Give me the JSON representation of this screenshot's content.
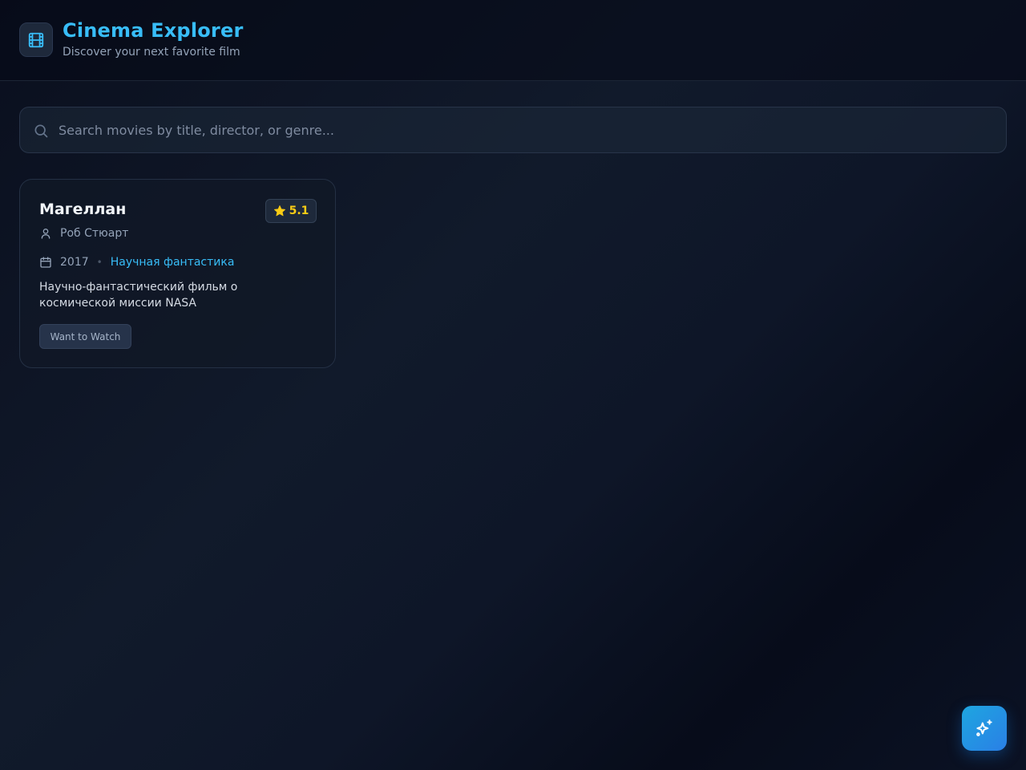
{
  "app": {
    "title": "Cinema Explorer",
    "subtitle": "Discover your next favorite film",
    "logo_icon": "film-icon",
    "accent_color": "#38bdf8"
  },
  "search": {
    "placeholder": "Search movies by title, director, or genre...",
    "value": "",
    "icon": "search-icon"
  },
  "movies": [
    {
      "title": "Магеллан",
      "rating": "5.1",
      "rating_icon": "star-icon",
      "director": "Роб Стюарт",
      "director_icon": "user-icon",
      "year": "2017",
      "year_icon": "calendar-icon",
      "genre": "Научная фантастика",
      "description": "Научно-фантастический фильм о космической миссии NASA",
      "action_label": "Want to Watch"
    }
  ],
  "fab": {
    "icon": "sparkles-icon"
  }
}
